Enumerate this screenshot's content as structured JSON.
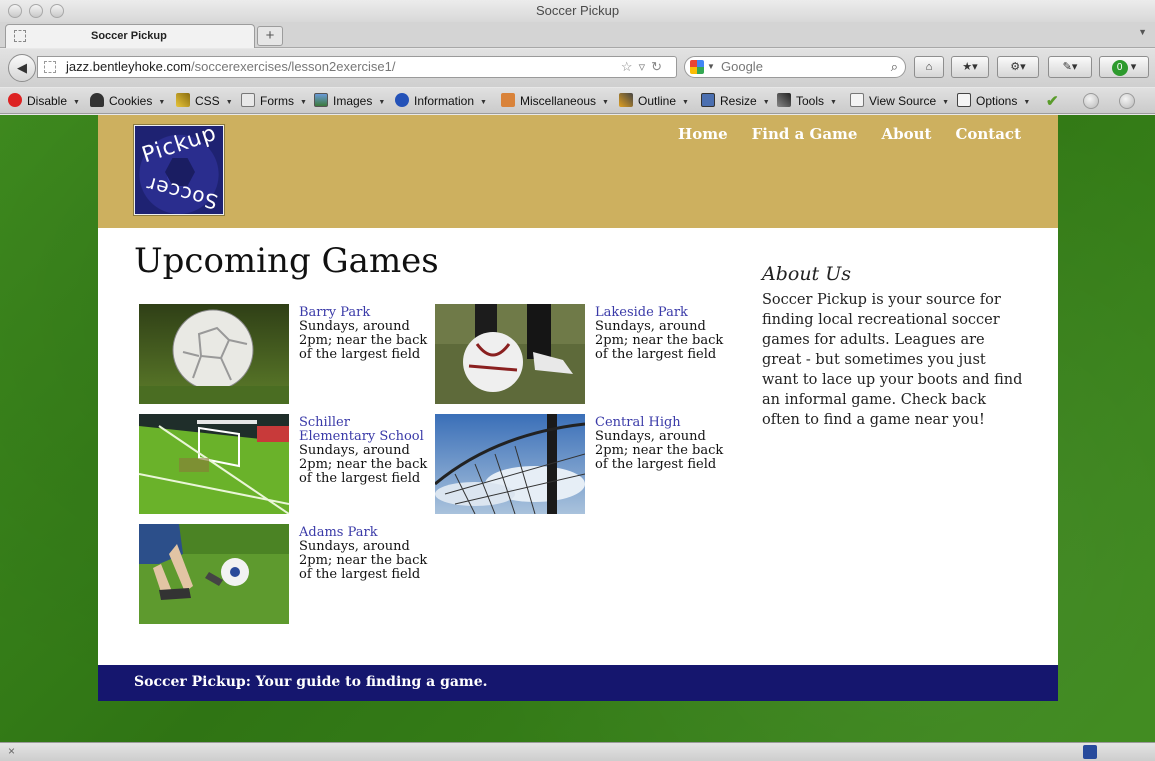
{
  "browser": {
    "window_title": "Soccer Pickup",
    "tab_label": "Soccer Pickup",
    "new_tab": "+",
    "url_host": "jazz.bentleyhoke.com",
    "url_path": "/soccerexercises/lesson2exercise1/",
    "search_placeholder": "Google",
    "addon_badge": "0"
  },
  "devbar": {
    "items": [
      {
        "label": "Disable",
        "icon": "disable-icon"
      },
      {
        "label": "Cookies",
        "icon": "cookies-icon"
      },
      {
        "label": "CSS",
        "icon": "css-icon"
      },
      {
        "label": "Forms",
        "icon": "forms-icon"
      },
      {
        "label": "Images",
        "icon": "images-icon"
      },
      {
        "label": "Information",
        "icon": "information-icon"
      },
      {
        "label": "Miscellaneous",
        "icon": "miscellaneous-icon"
      },
      {
        "label": "Outline",
        "icon": "outline-icon"
      },
      {
        "label": "Resize",
        "icon": "resize-icon"
      },
      {
        "label": "Tools",
        "icon": "tools-icon"
      },
      {
        "label": "View Source",
        "icon": "view-source-icon"
      },
      {
        "label": "Options",
        "icon": "options-icon"
      }
    ]
  },
  "site": {
    "logo": {
      "top": "Pickup",
      "bottom": "Soccer"
    },
    "nav": [
      "Home",
      "Find a Game",
      "About",
      "Contact"
    ],
    "main_title": "Upcoming Games",
    "games": [
      {
        "name": "Barry Park",
        "desc": "Sundays, around 2pm; near the back of the largest field"
      },
      {
        "name": "Lakeside Park",
        "desc": "Sundays, around 2pm; near the back of the largest field"
      },
      {
        "name": "Schiller Elementary School",
        "desc": "Sundays, around 2pm; near the back of the largest field"
      },
      {
        "name": "Central High",
        "desc": "Sundays, around 2pm; near the back of the largest field"
      },
      {
        "name": "Adams Park",
        "desc": "Sundays, around 2pm; near the back of the largest field"
      }
    ],
    "about_title": "About Us",
    "about_text": "Soccer Pickup is your source for finding local recreational soccer games for adults. Leagues are great - but sometimes you just want to lace up your boots and find an informal game. Check back often to find a game near you!",
    "footer": "Soccer Pickup: Your guide to finding a game."
  },
  "colors": {
    "header": "#cdb05f",
    "footer": "#15166e",
    "link": "#3a3aa8"
  }
}
